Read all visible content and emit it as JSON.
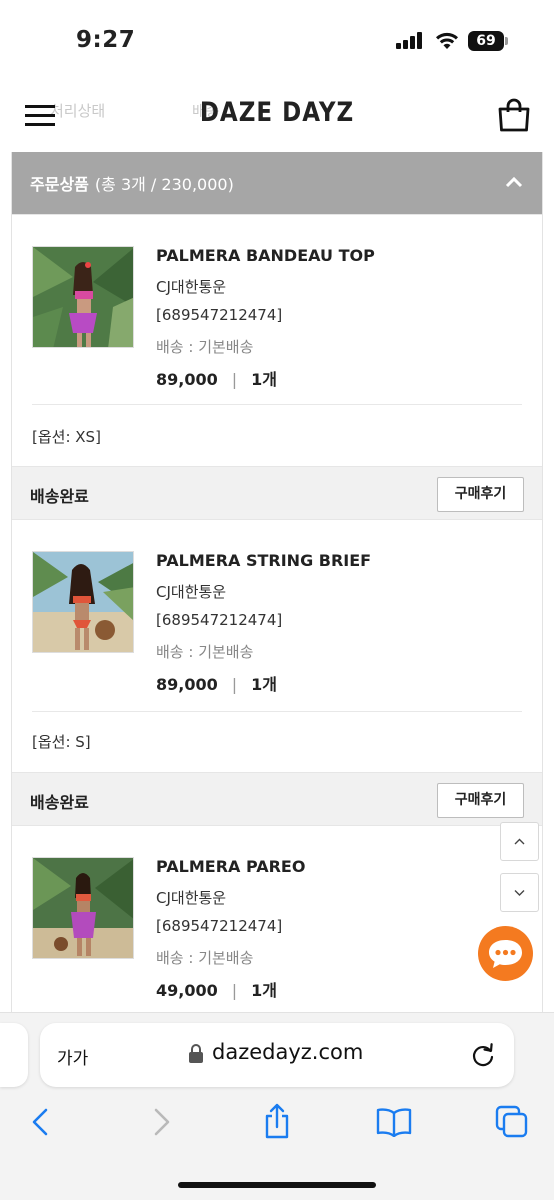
{
  "status_bar": {
    "time": "9:27",
    "battery": "69"
  },
  "header": {
    "brand": "DAZE DAYZ",
    "ghost_left": "처리상태",
    "ghost_mid": "배송"
  },
  "order": {
    "title": "주문상품",
    "summary": "(총 3개 / 230,000)"
  },
  "items": [
    {
      "name": "PALMERA BANDEAU TOP",
      "carrier": "CJ대한통운",
      "tracking": "[689547212474]",
      "shipping": "배송 : 기본배송",
      "price": "89,000",
      "separator": "|",
      "qty": "1개",
      "option": "[옵션: XS]",
      "status": "배송완료",
      "review_label": "구매후기"
    },
    {
      "name": "PALMERA STRING BRIEF",
      "carrier": "CJ대한통운",
      "tracking": "[689547212474]",
      "shipping": "배송 : 기본배송",
      "price": "89,000",
      "separator": "|",
      "qty": "1개",
      "option": "[옵션: S]",
      "status": "배송완료",
      "review_label": "구매후기"
    },
    {
      "name": "PALMERA PAREO",
      "carrier": "CJ대한통운",
      "tracking": "[689547212474]",
      "shipping": "배송 : 기본배송",
      "price": "49,000",
      "separator": "|",
      "qty": "1개"
    }
  ],
  "browser": {
    "text_size_label": "가가",
    "url": "dazedayz.com"
  },
  "colors": {
    "order_header_bg": "#a6a6a6",
    "chat_button": "#f47a20",
    "safari_blue": "#1a7cf0"
  },
  "icons": [
    "menu-icon",
    "shopping-bag-icon",
    "chevron-up-icon",
    "chevron-down-icon",
    "chat-bubble-icon",
    "lock-icon",
    "reload-icon",
    "back-icon",
    "forward-icon",
    "share-icon",
    "bookmarks-icon",
    "tabs-icon"
  ]
}
